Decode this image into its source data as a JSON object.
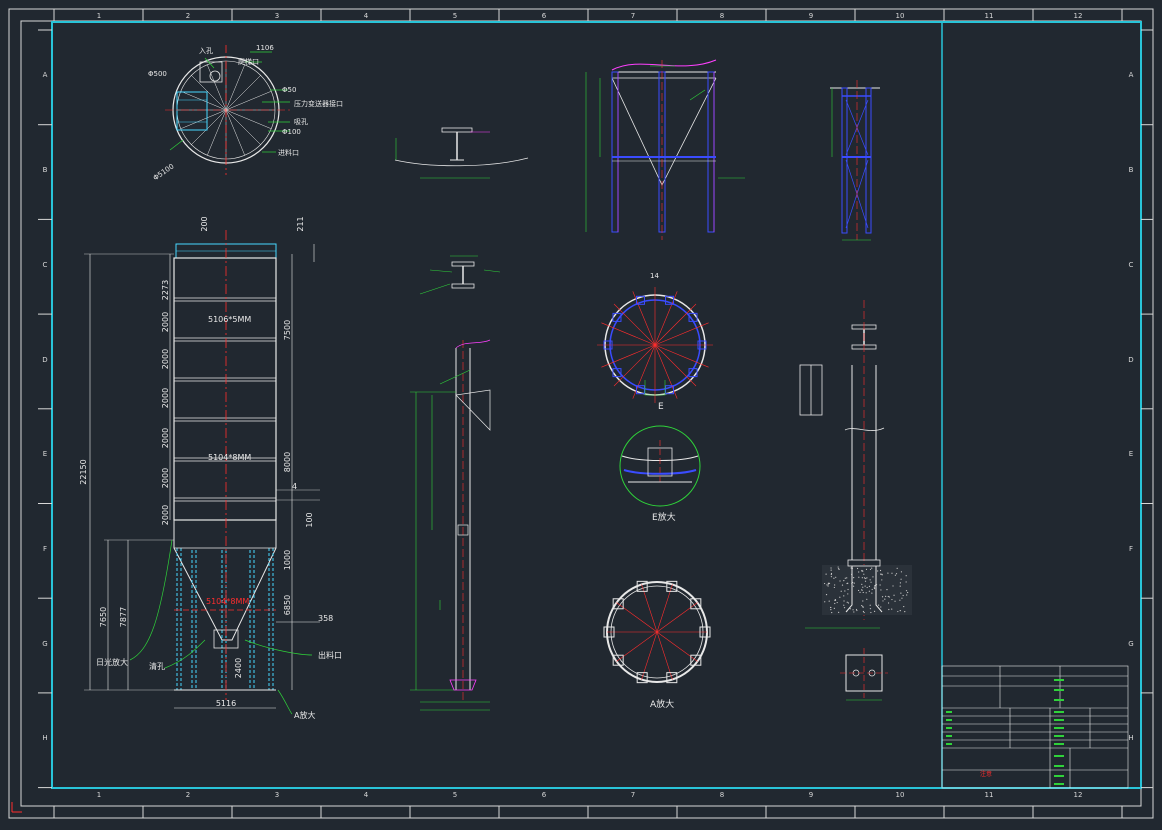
{
  "frame": {
    "col_labels": [
      "1",
      "2",
      "3",
      "4",
      "5",
      "6",
      "7",
      "8",
      "9",
      "10",
      "11",
      "12"
    ],
    "row_labels": [
      "A",
      "B",
      "C",
      "D",
      "E",
      "F",
      "G",
      "H"
    ]
  },
  "top_view": {
    "labels": [
      "入孔",
      "1106",
      "爬梯口",
      "Φ500",
      "Φ50",
      "压力变送器接口",
      "吸孔",
      "Φ100",
      "进料口",
      "Φ5100"
    ]
  },
  "elevation": {
    "left_dims": [
      "2273",
      "2000",
      "2000",
      "2000",
      "2000",
      "2000",
      "2000",
      "2000"
    ],
    "overall_height": "22150",
    "right_dims": [
      "7500",
      "8000",
      "100",
      "1000",
      "6850",
      "2400"
    ],
    "top_dims": [
      "200",
      "211"
    ],
    "left_lower_dims": [
      "7650",
      "7877"
    ],
    "bottom_width": "5116",
    "ring_label_top": "5106*5MM",
    "ring_label_mid": "5104*8MM",
    "ring_label_cone": "5104*8MM",
    "callout_358": "358",
    "callout_4": "4",
    "callout_left_1": "日光放大",
    "callout_left_2": "清孔",
    "callout_right_1": "出料口",
    "callout_right_2": "A放大"
  },
  "details": {
    "detail_e_label": "E放大",
    "detail_a_label": "A放大",
    "e_marker": "E",
    "ring_top_marker": "14"
  },
  "title_block": {
    "note": "注意"
  },
  "colors": {
    "background": "#212830",
    "frame": "#d8d8d8",
    "border": "#29c4d8",
    "drawing": "#e8e8e8",
    "dim_green": "#2fd23a",
    "center_red": "#ff2d2d",
    "member_blue": "#3a4cff",
    "member_magenta": "#ff40ff",
    "ladder_cyan": "#48d8ff"
  }
}
